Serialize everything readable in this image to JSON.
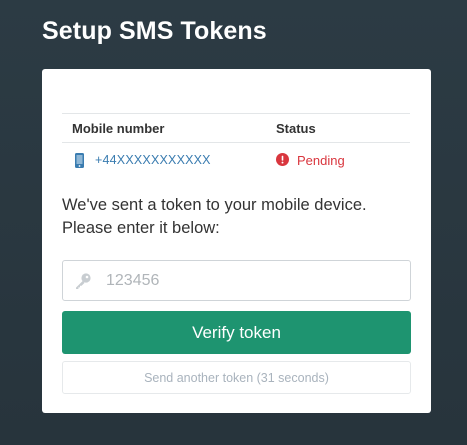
{
  "page": {
    "title": "Setup SMS Tokens"
  },
  "table": {
    "headers": {
      "number": "Mobile number",
      "status": "Status"
    },
    "rows": [
      {
        "number": "+44XXXXXXXXXXX",
        "status": "Pending",
        "phone_icon": "mobile-phone-icon",
        "status_icon": "alert-circle-icon"
      }
    ]
  },
  "instructions": {
    "line1": "We've sent a token to your mobile device.",
    "line2": "Please enter it below:"
  },
  "token": {
    "placeholder": "123456",
    "value": "",
    "icon": "key-icon"
  },
  "buttons": {
    "verify_label": "Verify token",
    "resend_label": "Send another token (31 seconds)"
  },
  "colors": {
    "accent": "#1e9470",
    "link": "#3a7cb0",
    "status_pending": "#d9363e",
    "background": "#2c3b44"
  }
}
